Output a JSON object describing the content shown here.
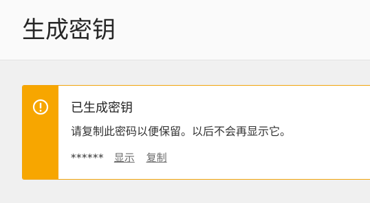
{
  "header": {
    "title": "生成密钥"
  },
  "message": {
    "icon": "warning-icon",
    "accent_color": "#f7a600",
    "title": "已生成密钥",
    "text": "请复制此密码以便保留。以后不会再显示它。",
    "key_value": "******",
    "show_label": "显示",
    "copy_label": "复制"
  }
}
